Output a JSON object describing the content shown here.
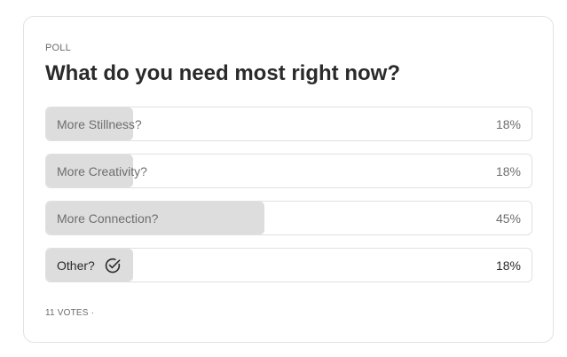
{
  "poll": {
    "label": "POLL",
    "question": "What do you need most right now?",
    "options": [
      {
        "label": "More Stillness?",
        "percent_text": "18%",
        "percent": 18,
        "selected": false
      },
      {
        "label": "More Creativity?",
        "percent_text": "18%",
        "percent": 18,
        "selected": false
      },
      {
        "label": "More Connection?",
        "percent_text": "45%",
        "percent": 45,
        "selected": false
      },
      {
        "label": "Other?",
        "percent_text": "18%",
        "percent": 18,
        "selected": true,
        "icon": "check-circle-icon"
      }
    ],
    "votes_text": "11 VOTES ·"
  }
}
